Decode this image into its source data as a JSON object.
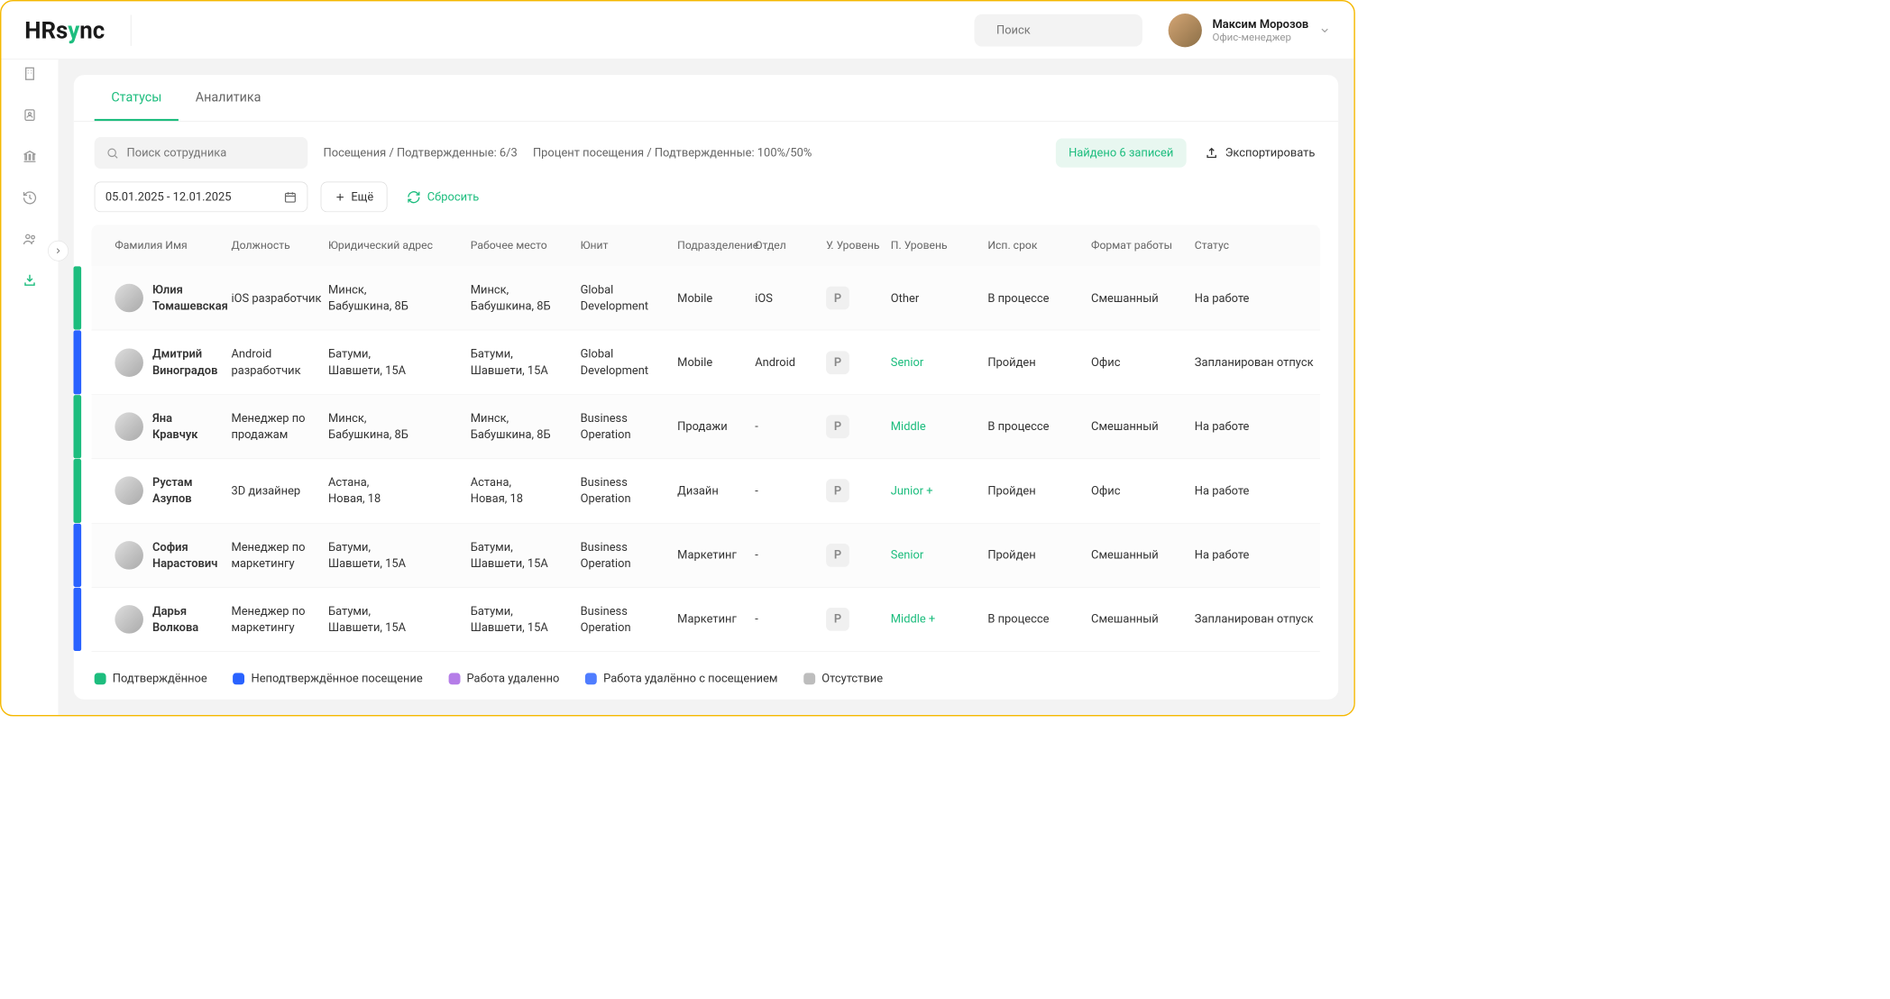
{
  "brand": {
    "part1": "HRs",
    "part2": "ync"
  },
  "search": {
    "placeholder": "Поиск"
  },
  "user": {
    "name": "Максим Морозов",
    "role": "Офис-менеджер"
  },
  "tabs": [
    {
      "label": "Статусы",
      "active": true
    },
    {
      "label": "Аналитика",
      "active": false
    }
  ],
  "empSearch": {
    "placeholder": "Поиск сотрудника"
  },
  "stats": {
    "visits": "Посещения / Подтвержденные: 6/3",
    "percent": "Процент посещения / Подтвержденные: 100%/50%"
  },
  "records": "Найдено 6 записей",
  "export": "Экспортировать",
  "dateRange": "05.01.2025 - 12.01.2025",
  "moreLabel": "Ещё",
  "resetLabel": "Сбросить",
  "columns": [
    "Фамилия Имя",
    "Должность",
    "Юридический адрес",
    "Рабочее место",
    "Юнит",
    "Подразделение",
    "Отдел",
    "У. Уровень",
    "П. Уровень",
    "Исп. срок",
    "Формат работы",
    "Статус"
  ],
  "rows": [
    {
      "barColor": "#1dbd7e",
      "firstName": "Юлия",
      "lastName": "Томашевская",
      "position": "iOS разработчик",
      "legalAddr": "Минск,\nБабушкина, 8Б",
      "workplace": "Минск,\nБабушкина, 8Б",
      "unit": "Global Development",
      "subdiv": "Mobile",
      "dept": "iOS",
      "uLevel": "P",
      "pLevel": "Other",
      "pLevelColor": "#333",
      "term": "В процессе",
      "format": "Смешанный",
      "status": "На работе"
    },
    {
      "barColor": "#2962ff",
      "firstName": "Дмитрий",
      "lastName": "Виноградов",
      "position": "Android разработчик",
      "legalAddr": "Батуми,\nШавшети, 15А",
      "workplace": "Батуми,\nШавшети, 15А",
      "unit": "Global Development",
      "subdiv": "Mobile",
      "dept": "Android",
      "uLevel": "P",
      "pLevel": "Senior",
      "pLevelColor": "#1dbd7e",
      "term": "Пройден",
      "format": "Офис",
      "status": "Запланирован отпуск"
    },
    {
      "barColor": "#1dbd7e",
      "firstName": "Яна",
      "lastName": "Кравчук",
      "position": "Менеджер по продажам",
      "legalAddr": "Минск,\nБабушкина, 8Б",
      "workplace": "Минск,\nБабушкина, 8Б",
      "unit": "Business Operation",
      "subdiv": "Продажи",
      "dept": "-",
      "uLevel": "P",
      "pLevel": "Middle",
      "pLevelColor": "#1dbd7e",
      "term": "В процессе",
      "format": "Смешанный",
      "status": "На работе"
    },
    {
      "barColor": "#1dbd7e",
      "firstName": "Рустам",
      "lastName": "Азупов",
      "position": "3D дизайнер",
      "legalAddr": "Астана,\nНовая, 18",
      "workplace": "Астана,\nНовая, 18",
      "unit": "Business Operation",
      "subdiv": "Дизайн",
      "dept": "-",
      "uLevel": "P",
      "pLevel": "Junior +",
      "pLevelColor": "#1dbd7e",
      "term": "Пройден",
      "format": "Офис",
      "status": "На работе"
    },
    {
      "barColor": "#2962ff",
      "firstName": "София",
      "lastName": "Нарастович",
      "position": "Менеджер по маркетингу",
      "legalAddr": "Батуми,\nШавшети, 15А",
      "workplace": "Батуми,\nШавшети, 15А",
      "unit": "Business Operation",
      "subdiv": "Маркетинг",
      "dept": "-",
      "uLevel": "P",
      "pLevel": "Senior",
      "pLevelColor": "#1dbd7e",
      "term": "Пройден",
      "format": "Смешанный",
      "status": "На работе"
    },
    {
      "barColor": "#2962ff",
      "firstName": "Дарья",
      "lastName": "Волкова",
      "position": "Менеджер по маркетингу",
      "legalAddr": "Батуми,\nШавшети, 15А",
      "workplace": "Батуми,\nШавшети, 15А",
      "unit": "Business Operation",
      "subdiv": "Маркетинг",
      "dept": "-",
      "uLevel": "P",
      "pLevel": "Middle +",
      "pLevelColor": "#1dbd7e",
      "term": "В процессе",
      "format": "Смешанный",
      "status": "Запланирован отпуск"
    }
  ],
  "legend": [
    {
      "color": "#1dbd7e",
      "label": "Подтверждённое"
    },
    {
      "color": "#2962ff",
      "label": "Неподтверждённое посещение"
    },
    {
      "color": "#b57de8",
      "label": "Работа удаленно"
    },
    {
      "color": "#4f7dff",
      "label": "Работа удалённо с посещением"
    },
    {
      "color": "#bdbdbd",
      "label": "Отсутствие"
    }
  ]
}
